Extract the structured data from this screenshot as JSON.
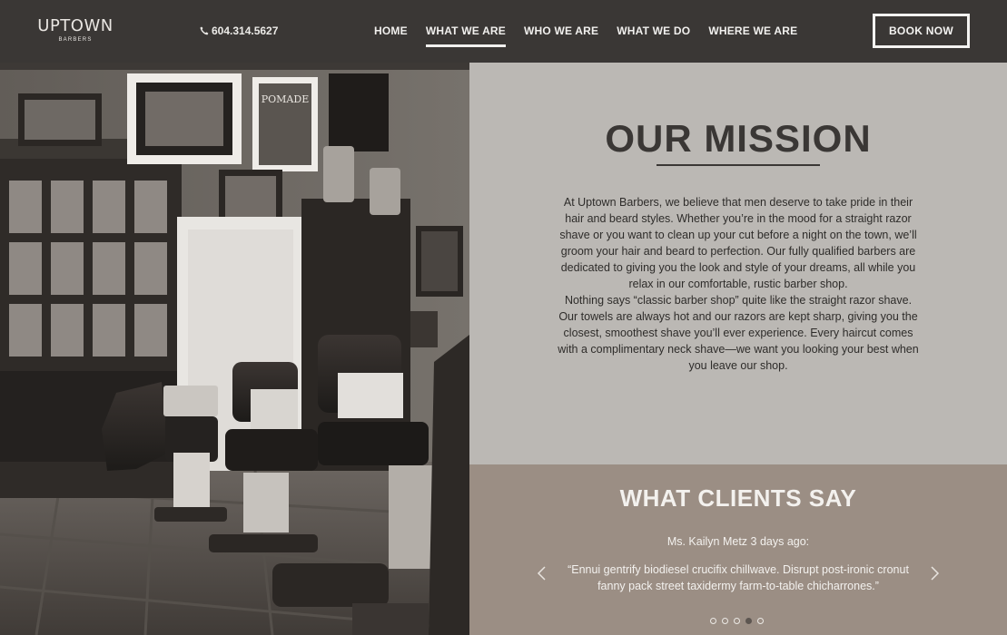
{
  "brand": {
    "name": "UPTOWN",
    "subtitle": "BARBERS"
  },
  "header": {
    "phone": "604.314.5627",
    "nav": [
      {
        "label": "HOME",
        "active": false
      },
      {
        "label": "WHAT WE ARE",
        "active": true
      },
      {
        "label": "WHO WE ARE",
        "active": false
      },
      {
        "label": "WHAT WE DO",
        "active": false
      },
      {
        "label": "WHERE WE ARE",
        "active": false
      }
    ],
    "book_label": "BOOK NOW"
  },
  "hero_image": {
    "sign_text": "POMADE"
  },
  "mission": {
    "title": "OUR MISSION",
    "paragraph_1": "At Uptown Barbers, we believe that men deserve to take pride in their hair and beard styles. Whether you’re in the mood for a straight razor shave or you want to clean up your cut before a night on the town, we’ll groom your hair and beard to perfection. Our fully qualified barbers are dedicated to giving you the look and style of your dreams, all while you relax in our comfortable, rustic barber shop.",
    "paragraph_2": "Nothing says “classic barber shop” quite like the straight razor shave. Our towels are always hot and our razors are kept sharp, giving you the closest, smoothest shave you’ll ever experience. Every haircut comes with a complimentary neck shave—we want you looking your best when you leave our shop."
  },
  "testimonials": {
    "title": "WHAT CLIENTS SAY",
    "author": "Ms. Kailyn Metz 3 days ago:",
    "quote": "“Ennui gentrify biodiesel crucifix chillwave. Disrupt post-ironic cronut fanny pack street taxidermy farm-to-table chicharrones.”",
    "slide_count": 5,
    "active_slide": 4
  },
  "colors": {
    "header_bg": "#3a3735",
    "mission_bg": "#bbb8b4",
    "clients_bg": "#9b8e84",
    "dark_text": "#3a3735",
    "light_text": "#f3f1ee"
  },
  "icons": {
    "phone": "phone-icon",
    "prev": "chevron-left-icon",
    "next": "chevron-right-icon"
  }
}
